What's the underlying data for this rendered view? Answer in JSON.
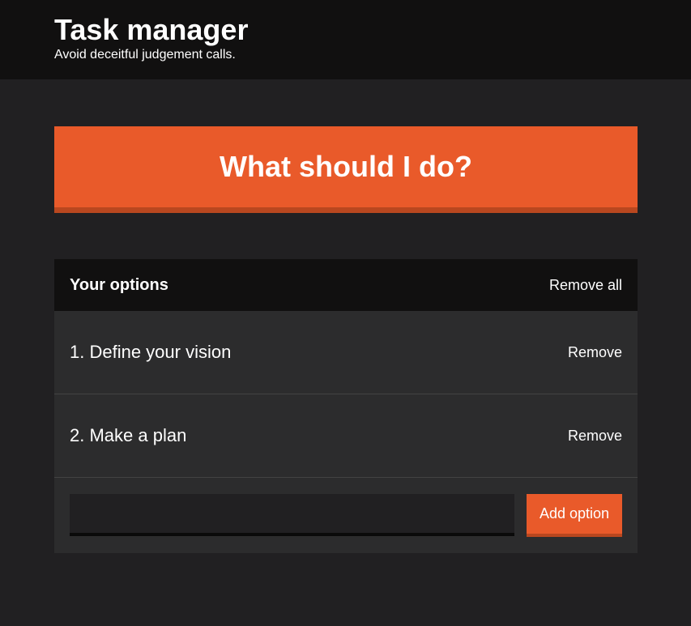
{
  "header": {
    "title": "Task manager",
    "subtitle": "Avoid deceitful judgement calls."
  },
  "main": {
    "action_button_label": "What should I do?"
  },
  "options_widget": {
    "title": "Your options",
    "remove_all_label": "Remove all",
    "options": [
      {
        "text": "1. Define your vision",
        "remove_label": "Remove"
      },
      {
        "text": "2. Make a plan",
        "remove_label": "Remove"
      }
    ],
    "input_value": "",
    "add_button_label": "Add option"
  },
  "colors": {
    "accent": "#e95a2a",
    "accent_dark": "#b9471f",
    "page_background": "#212022",
    "header_background": "#111010",
    "widget_background": "#2c2c2d"
  }
}
